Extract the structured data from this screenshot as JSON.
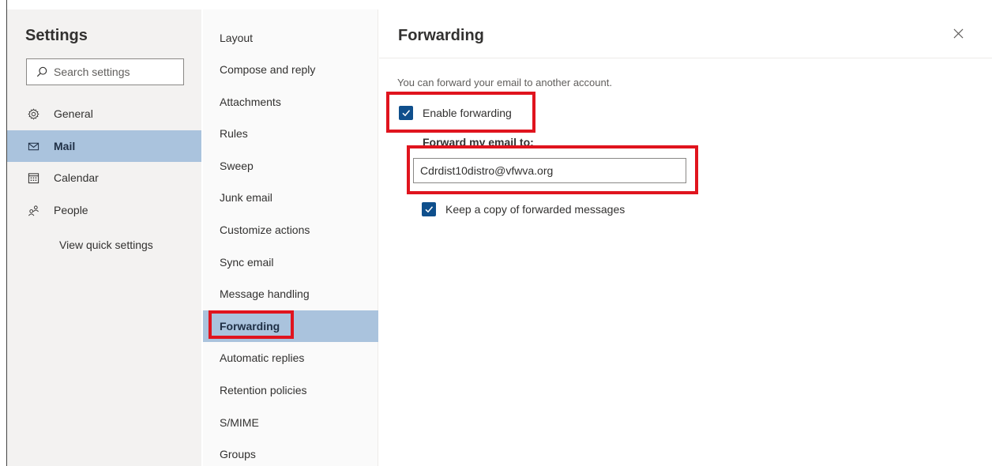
{
  "settings_pane": {
    "title": "Settings",
    "search_placeholder": "Search settings",
    "nav": [
      {
        "label": "General",
        "icon": "gear-icon",
        "selected": false
      },
      {
        "label": "Mail",
        "icon": "mail-icon",
        "selected": true
      },
      {
        "label": "Calendar",
        "icon": "calendar-icon",
        "selected": false
      },
      {
        "label": "People",
        "icon": "people-icon",
        "selected": false
      }
    ],
    "quick_settings_link": "View quick settings"
  },
  "mail_subnav": {
    "items": [
      "Layout",
      "Compose and reply",
      "Attachments",
      "Rules",
      "Sweep",
      "Junk email",
      "Customize actions",
      "Sync email",
      "Message handling",
      "Forwarding",
      "Automatic replies",
      "Retention policies",
      "S/MIME",
      "Groups"
    ],
    "selected": "Forwarding"
  },
  "forwarding_panel": {
    "title": "Forwarding",
    "description": "You can forward your email to another account.",
    "enable_label": "Enable forwarding",
    "enable_checked": true,
    "forward_to_label": "Forward my email to:",
    "forward_to_value": "Cdrdist10distro@vfwva.org",
    "keep_copy_label": "Keep a copy of forwarded messages",
    "keep_copy_checked": true
  },
  "colors": {
    "selected_bg": "#aac3dd",
    "checkbox": "#0f4f8c",
    "highlight": "#e0141e",
    "pane_bg": "#f3f2f1"
  }
}
